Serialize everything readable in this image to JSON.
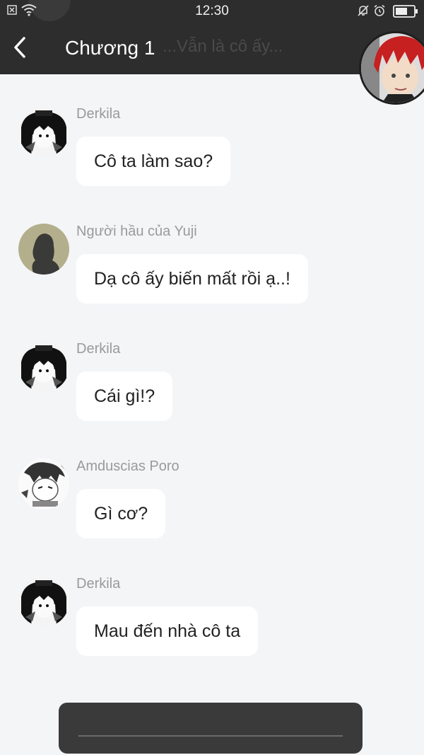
{
  "status_bar": {
    "time": "12:30"
  },
  "header": {
    "title": "Chương 1",
    "ghost_preview": "...Vẫn là cô ấy..."
  },
  "messages": [
    {
      "sender": "Derkila",
      "text": "Cô ta làm sao?",
      "avatar": "derkila-avatar"
    },
    {
      "sender": "Người hầu của Yuji",
      "text": "Dạ cô ấy biến mất rồi ạ..!",
      "avatar": "silhouette-avatar"
    },
    {
      "sender": "Derkila",
      "text": "Cái gì!?",
      "avatar": "derkila-avatar"
    },
    {
      "sender": "Amduscias Poro",
      "text": "Gì cơ?",
      "avatar": "amduscias-avatar"
    },
    {
      "sender": "Derkila",
      "text": "Mau đến nhà cô ta",
      "avatar": "derkila-avatar"
    }
  ],
  "colors": {
    "header_bg": "#2d2d2d",
    "page_bg": "#f4f5f7",
    "bubble_bg": "#ffffff",
    "sender_text": "#9a9a9a",
    "input_bar_bg": "#3a3a3a"
  }
}
